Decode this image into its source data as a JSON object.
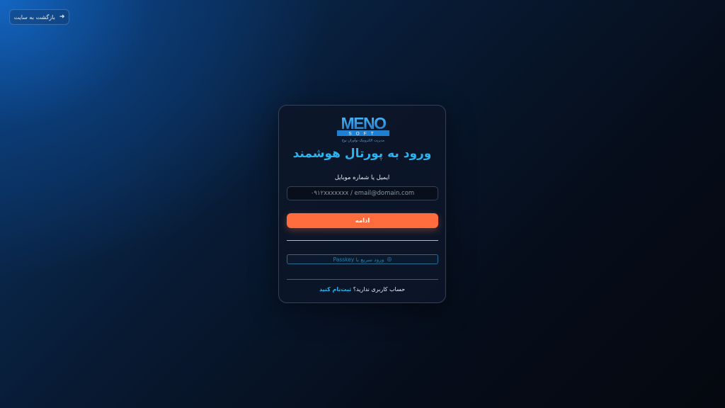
{
  "nav": {
    "back_label": "بازگشت به سایت",
    "back_icon": "arrow-right-icon"
  },
  "brand": {
    "logo_text": "MENO",
    "logo_subtext": "SOFT",
    "logo_tagline": "مدیریت الکترونیک نوآوران نوح",
    "accent_color": "#2bb3f0"
  },
  "login": {
    "title": "ورود به پورتال هوشمند",
    "field_label": "ایمیل یا شماره موبایل",
    "input_value": "",
    "input_placeholder": "۰۹۱۲xxxxxxx / email@domain.com",
    "continue_label": "ادامه",
    "continue_color": "#ff6d3f",
    "passkey_label": "ورود سریع با Passkey",
    "passkey_icon": "fingerprint-icon",
    "register_question": "حساب کاربری ندارید؟",
    "register_link": "ثبت‌نام کنید"
  }
}
